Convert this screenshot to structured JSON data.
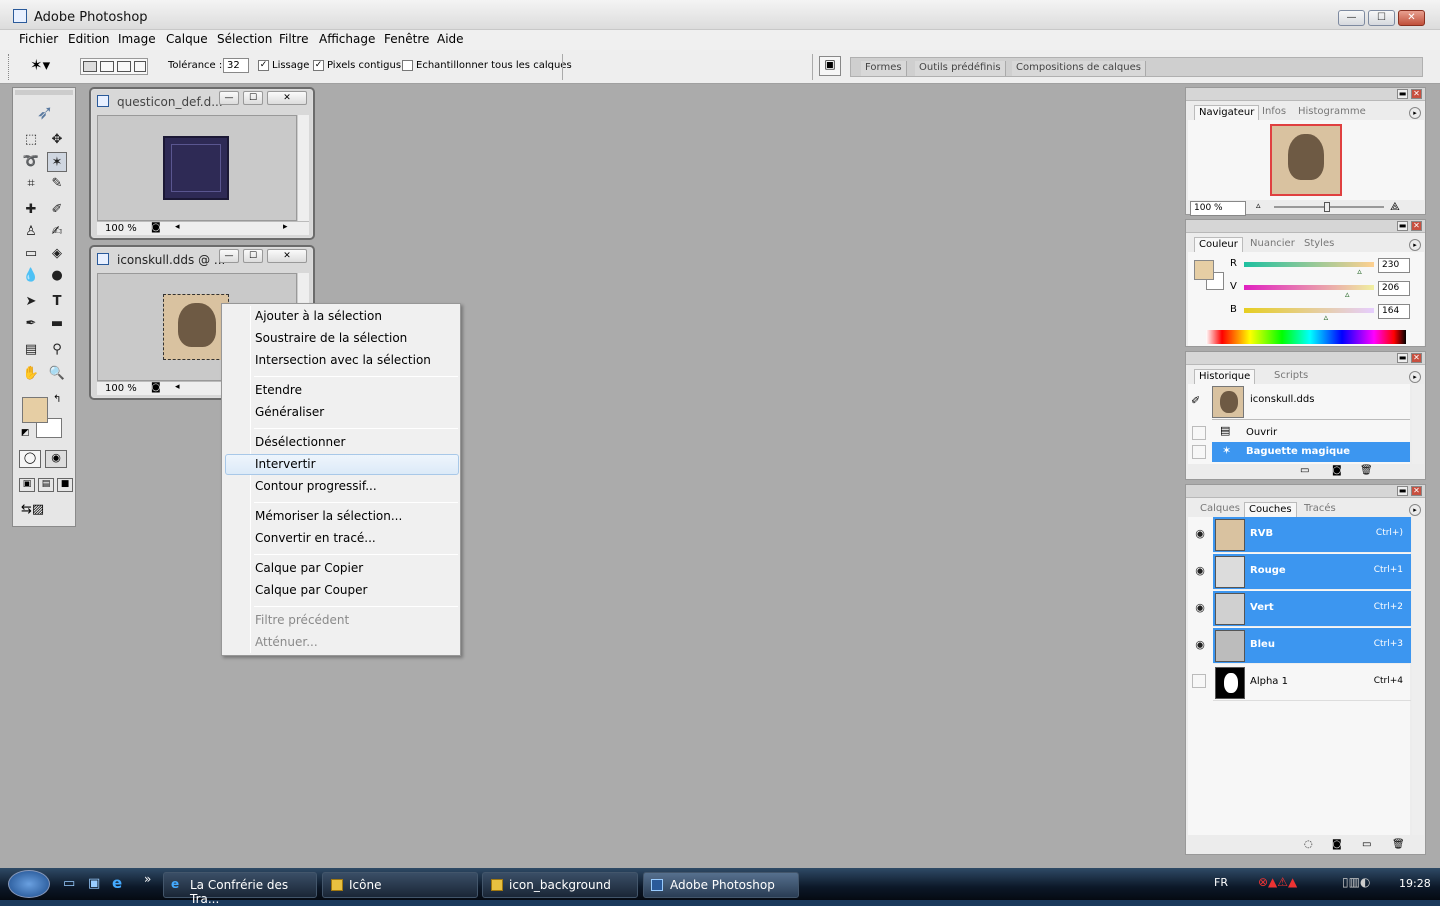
{
  "window": {
    "title": "Adobe Photoshop",
    "min_label": "—",
    "max_label": "☐",
    "close_label": "✕"
  },
  "menu": [
    "Fichier",
    "Edition",
    "Image",
    "Calque",
    "Sélection",
    "Filtre",
    "Affichage",
    "Fenêtre",
    "Aide"
  ],
  "options": {
    "tolerance_label": "Tolérance :",
    "tolerance_value": "32",
    "antialias_label": "Lissage",
    "antialias_checked": true,
    "contiguous_label": "Pixels contigus",
    "contiguous_checked": true,
    "sample_all_label": "Echantillonner tous les calques",
    "sample_all_checked": false
  },
  "palette_well": {
    "tabs": [
      "Formes",
      "Outils prédéfinis",
      "Compositions de calques"
    ]
  },
  "documents": [
    {
      "title": "questicon_def.d...",
      "zoom": "100 %",
      "swatch_color": "#2e2a55"
    },
    {
      "title": "iconskull.dds @ ...",
      "zoom": "100 %",
      "swatch_color": "#d9c2a0"
    }
  ],
  "context_menu": {
    "items": [
      {
        "label": "Ajouter à la sélection",
        "disabled": false
      },
      {
        "label": "Soustraire de la sélection",
        "disabled": false
      },
      {
        "label": "Intersection avec la sélection",
        "disabled": false
      },
      {
        "label": "Etendre",
        "disabled": false
      },
      {
        "label": "Généraliser",
        "disabled": false
      },
      {
        "label": "Désélectionner",
        "disabled": false
      },
      {
        "label": "Intervertir",
        "disabled": false,
        "highlighted": true
      },
      {
        "label": "Contour progressif...",
        "disabled": false
      },
      {
        "label": "Mémoriser la sélection...",
        "disabled": false
      },
      {
        "label": "Convertir en tracé...",
        "disabled": false
      },
      {
        "label": "Calque par Copier",
        "disabled": false
      },
      {
        "label": "Calque par Couper",
        "disabled": false
      },
      {
        "label": "Filtre précédent",
        "disabled": true
      },
      {
        "label": "Atténuer...",
        "disabled": true
      }
    ]
  },
  "navigator": {
    "tabs": [
      "Navigateur",
      "Infos",
      "Histogramme"
    ],
    "zoom": "100 %"
  },
  "color": {
    "tabs": [
      "Couleur",
      "Nuancier",
      "Styles"
    ],
    "foreground": "#e6cea4",
    "r_label": "R",
    "r_value": "230",
    "r_level": 0.902,
    "g_label": "V",
    "g_value": "206",
    "g_level": 0.808,
    "b_label": "B",
    "b_value": "164",
    "b_level": 0.643
  },
  "history": {
    "tabs": [
      "Historique",
      "Scripts"
    ],
    "snapshot": "iconskull.dds",
    "states": [
      {
        "label": "Ouvrir",
        "selected": false
      },
      {
        "label": "Baguette magique",
        "selected": true
      }
    ]
  },
  "channels": {
    "tabs": [
      "Calques",
      "Couches",
      "Tracés"
    ],
    "rows": [
      {
        "name": "RVB",
        "shortcut": "Ctrl+)",
        "selected": true,
        "visible": true
      },
      {
        "name": "Rouge",
        "shortcut": "Ctrl+1",
        "selected": true,
        "visible": true
      },
      {
        "name": "Vert",
        "shortcut": "Ctrl+2",
        "selected": true,
        "visible": true
      },
      {
        "name": "Bleu",
        "shortcut": "Ctrl+3",
        "selected": true,
        "visible": true
      },
      {
        "name": "Alpha 1",
        "shortcut": "Ctrl+4",
        "selected": false,
        "visible": false
      }
    ]
  },
  "taskbar": {
    "buttons": [
      {
        "label": "La Confrérie des Tra...",
        "icon": "ie-icon",
        "active": false
      },
      {
        "label": "Icône",
        "icon": "folder-icon",
        "active": false
      },
      {
        "label": "icon_background",
        "icon": "folder-icon",
        "active": false
      },
      {
        "label": "Adobe Photoshop",
        "icon": "photoshop-icon",
        "active": true
      }
    ],
    "lang": "FR",
    "clock": "19:28",
    "quicklaunch_more": "»"
  }
}
